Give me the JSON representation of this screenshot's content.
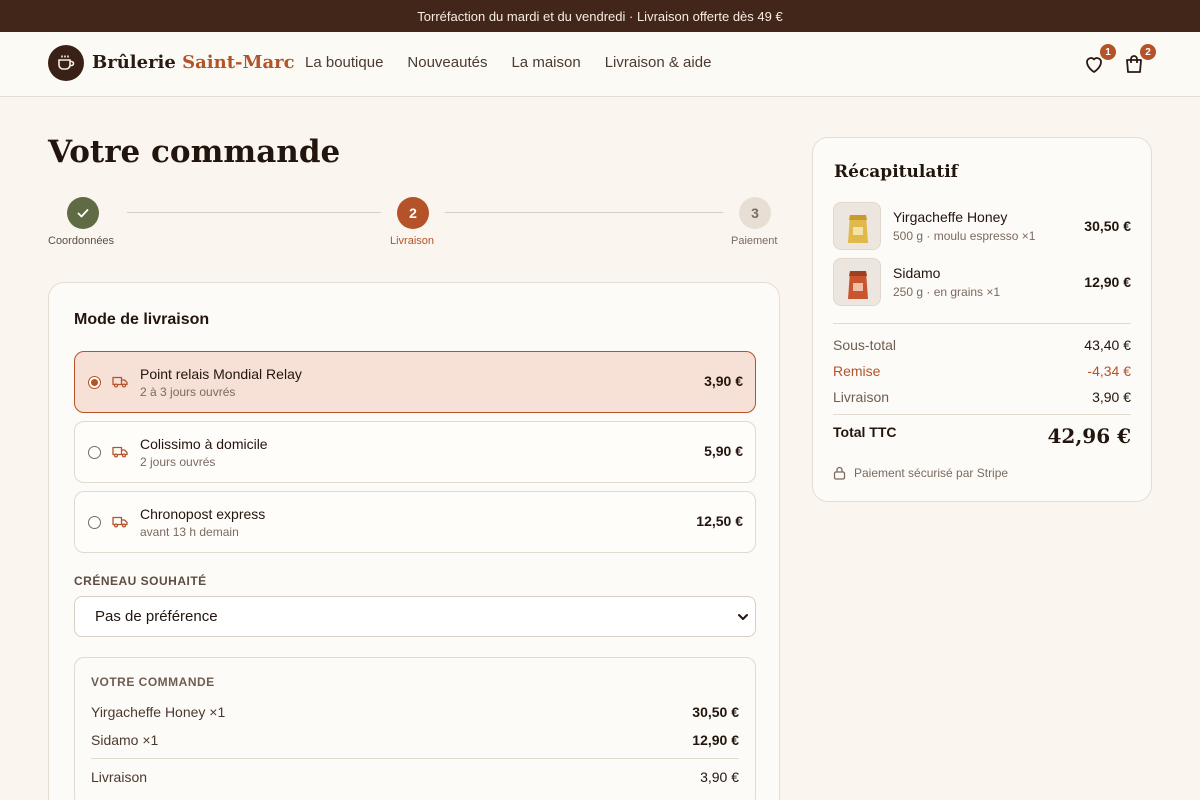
{
  "topbar": {
    "text": "Torréfaction du mardi et du vendredi · Livraison offerte dès 49 €"
  },
  "header": {
    "brand_main": "Brûlerie",
    "brand_accent": "Saint-Marc",
    "nav": [
      "La boutique",
      "Nouveautés",
      "La maison",
      "Livraison & aide"
    ],
    "wishlist_count": "1",
    "cart_count": "2"
  },
  "page": {
    "title": "Votre commande"
  },
  "steps": [
    {
      "label": "Coordonnées",
      "state": "done"
    },
    {
      "label": "Livraison",
      "number": "2",
      "state": "active"
    },
    {
      "label": "Paiement",
      "number": "3",
      "state": "todo"
    }
  ],
  "delivery": {
    "title": "Mode de livraison",
    "options": [
      {
        "name": "Point relais Mondial Relay",
        "sub": "2 à 3 jours ouvrés",
        "price": "3,90 €",
        "selected": true
      },
      {
        "name": "Colissimo à domicile",
        "sub": "2 jours ouvrés",
        "price": "5,90 €",
        "selected": false
      },
      {
        "name": "Chronopost express",
        "sub": "avant 13 h demain",
        "price": "12,50 €",
        "selected": false
      }
    ],
    "slot_label": "CRÉNEAU SOUHAITÉ",
    "slot_value": "Pas de préférence"
  },
  "order_box": {
    "title": "VOTRE COMMANDE",
    "rows": [
      {
        "label": "Yirgacheffe Honey ×1",
        "value": "30,50 €"
      },
      {
        "label": "Sidamo ×1",
        "value": "12,90 €"
      }
    ],
    "shipping_label": "Livraison",
    "shipping_value": "3,90 €"
  },
  "summary": {
    "title": "Récapitulatif",
    "items": [
      {
        "name": "Yirgacheffe Honey",
        "sub": "500 g · moulu espresso ×1",
        "price": "30,50 €"
      },
      {
        "name": "Sidamo",
        "sub": "250 g · en grains ×1",
        "price": "12,90 €"
      }
    ],
    "subtotal_label": "Sous-total",
    "subtotal": "43,40 €",
    "discount_label": "Remise",
    "discount": "-4,34 €",
    "shipping_label": "Livraison",
    "shipping": "3,90 €",
    "total_label": "Total TTC",
    "total": "42,96 €",
    "secure": "Paiement sécurisé par Stripe"
  },
  "colors": {
    "accent": "#b4532a",
    "dark": "#43261a",
    "done": "#5f6b45",
    "selected_bg": "#f7e0d6"
  }
}
